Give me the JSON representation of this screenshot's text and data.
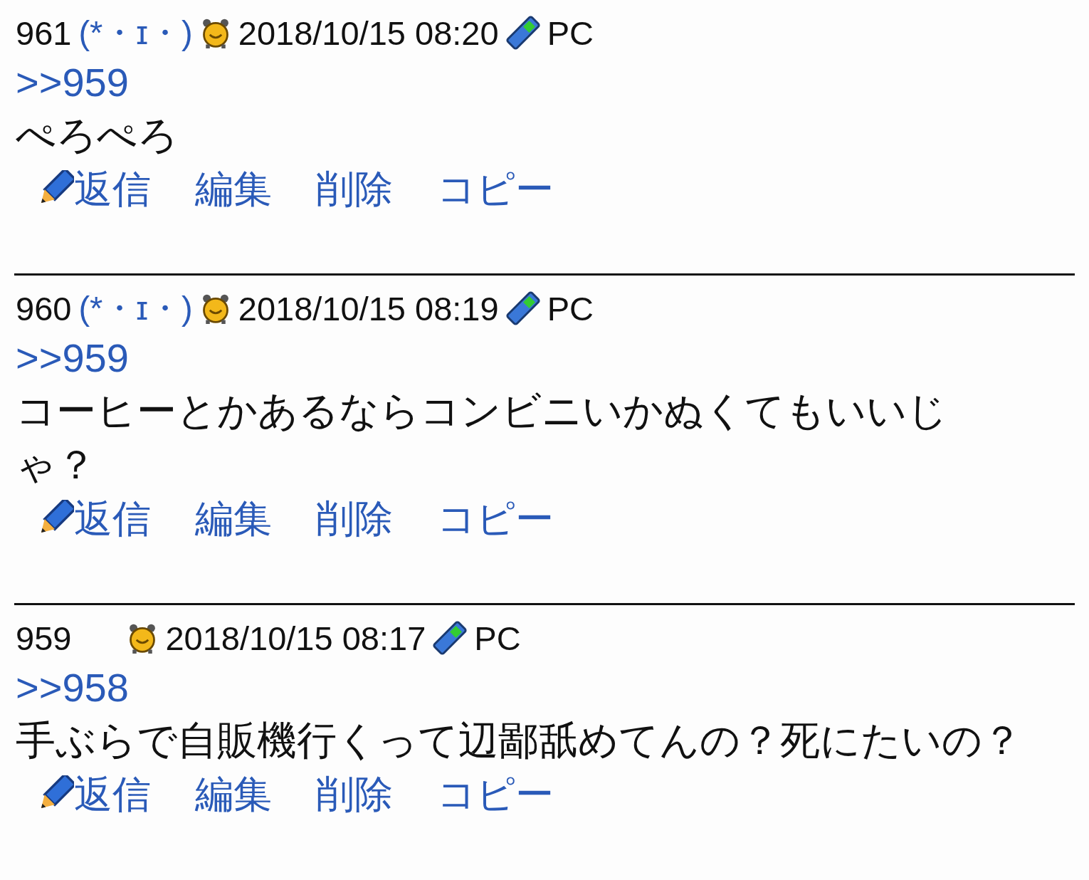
{
  "posts": [
    {
      "number": "961",
      "name": "(*・ɪ・)",
      "date": "2018/10/15 08:20",
      "device": "PC",
      "anchor": ">>959",
      "body": "ぺろぺろ",
      "actions": [
        "返信",
        "編集",
        "削除",
        "コピー"
      ]
    },
    {
      "number": "960",
      "name": "(*・ɪ・)",
      "date": "2018/10/15 08:19",
      "device": "PC",
      "anchor": ">>959",
      "body": "コーヒーとかあるならコンビニいかぬくてもいいじゃ？",
      "actions": [
        "返信",
        "編集",
        "削除",
        "コピー"
      ]
    },
    {
      "number": "959",
      "date": "2018/10/15 08:17",
      "device": "PC",
      "anchor": ">>958",
      "body": "手ぶらで自販機行くって辺鄙舐めてんの？死にたいの？",
      "actions": [
        "返信",
        "編集",
        "削除",
        "コピー"
      ]
    }
  ]
}
